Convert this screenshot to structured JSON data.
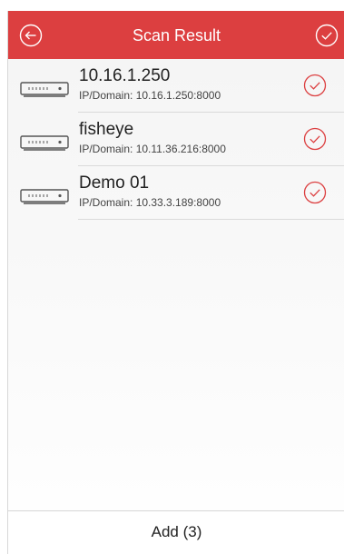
{
  "header": {
    "title": "Scan Result",
    "back_icon": "back-arrow-circle-icon",
    "confirm_icon": "check-circle-icon",
    "color": "#dc3f40"
  },
  "devices": [
    {
      "name": "10.16.1.250",
      "address": "IP/Domain: 10.16.1.250:8000",
      "selected": true,
      "icon": "device-recorder-icon"
    },
    {
      "name": "fisheye",
      "address": "IP/Domain: 10.11.36.216:8000",
      "selected": true,
      "icon": "device-recorder-icon"
    },
    {
      "name": "Demo 01",
      "address": "IP/Domain: 10.33.3.189:8000",
      "selected": true,
      "icon": "device-recorder-icon"
    }
  ],
  "footer": {
    "add_label": "Add (3)"
  }
}
